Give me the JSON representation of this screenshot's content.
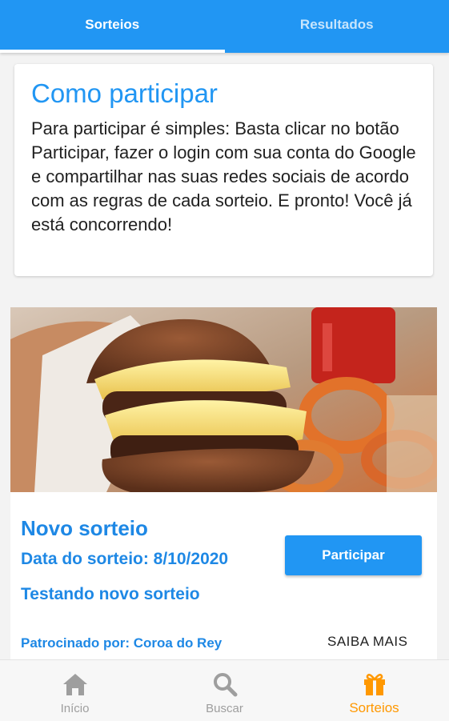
{
  "top_tabs": [
    {
      "label": "Sorteios",
      "active": true
    },
    {
      "label": "Resultados",
      "active": false
    }
  ],
  "info_card": {
    "title": "Como participar",
    "text": "Para participar é simples: Basta clicar no botão Participar, fazer o login com sua conta do Google e compartilhar nas suas redes sociais de acordo com as regras de cada sorteio. E pronto! Você já está concorrendo!"
  },
  "raffle": {
    "title": "Novo sorteio",
    "date": "Data do sorteio: 8/10/2020",
    "description": "Testando novo sorteio",
    "sponsor": "Patrocinado por: Coroa do Rey",
    "participate_label": "Participar",
    "more_label": "SAIBA MAIS"
  },
  "bottom_nav": [
    {
      "label": "Início",
      "icon": "home-icon",
      "active": false
    },
    {
      "label": "Buscar",
      "icon": "search-icon",
      "active": false
    },
    {
      "label": "Sorteios",
      "icon": "gift-icon",
      "active": true
    }
  ],
  "colors": {
    "primary": "#2196F3",
    "accent": "#ff9800",
    "text": "#212121"
  }
}
